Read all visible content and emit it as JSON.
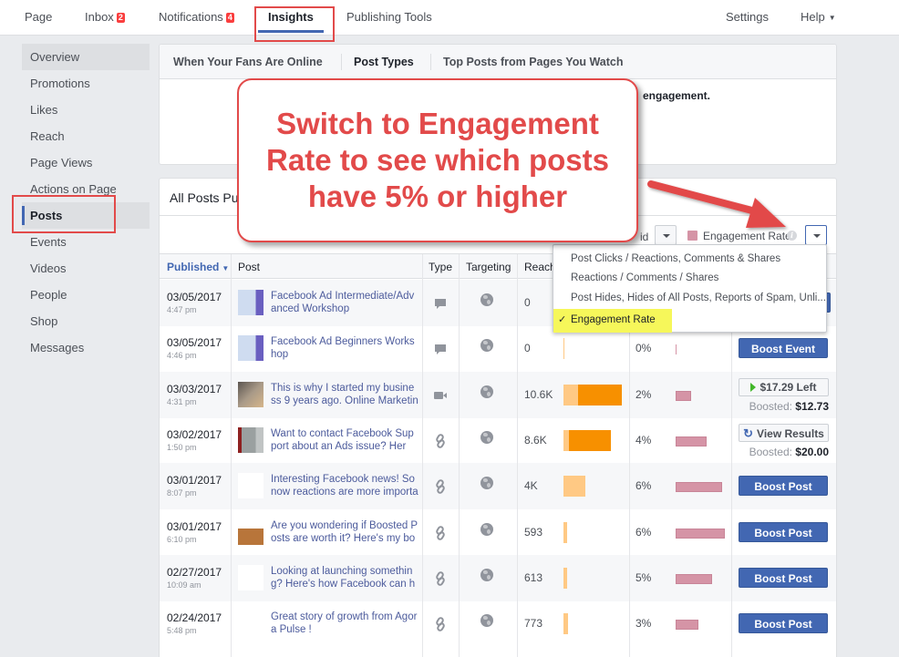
{
  "topnav": {
    "tabs": [
      {
        "label": "Page"
      },
      {
        "label": "Inbox",
        "badge": "2"
      },
      {
        "label": "Notifications",
        "badge": "4"
      },
      {
        "label": "Insights",
        "active": true
      },
      {
        "label": "Publishing Tools"
      }
    ],
    "settings": "Settings",
    "help": "Help",
    "help_caret": "▼"
  },
  "sidebar": {
    "items": [
      {
        "label": "Overview"
      },
      {
        "label": "Promotions"
      },
      {
        "label": "Likes"
      },
      {
        "label": "Reach"
      },
      {
        "label": "Page Views"
      },
      {
        "label": "Actions on Page"
      },
      {
        "label": "Posts",
        "active": true
      },
      {
        "label": "Events"
      },
      {
        "label": "Videos"
      },
      {
        "label": "People"
      },
      {
        "label": "Shop"
      },
      {
        "label": "Messages"
      }
    ]
  },
  "subtabs": {
    "items": [
      {
        "label": "When Your Fans Are Online"
      },
      {
        "label": "Post Types",
        "active": true
      },
      {
        "label": "Top Posts from Pages You Watch"
      }
    ],
    "body_text": "engagement."
  },
  "posts_card": {
    "title": "All Posts Pu",
    "paid_label": "id",
    "metric_label": "Engagement Rate",
    "info": "i",
    "metric_color": "#d594a6"
  },
  "table": {
    "headers": {
      "published": "Published",
      "sort_caret": "▼",
      "post": "Post",
      "type": "Type",
      "targeting": "Targeting",
      "reach": "Reach"
    },
    "rows": [
      {
        "date": "03/05/2017",
        "time": "4:47 pm",
        "text": "Facebook Ad Intermediate/Advanced Workshop",
        "type": "comment-icon",
        "targeting": "globe-icon",
        "reach": "0",
        "reach_organic": 0,
        "reach_paid": 0,
        "engagement": "",
        "engagement_value": 0,
        "action": "hidden"
      },
      {
        "date": "03/05/2017",
        "time": "4:46 pm",
        "text": "Facebook Ad Beginners Workshop",
        "type": "comment-icon",
        "targeting": "globe-icon",
        "reach": "0",
        "reach_organic": 0,
        "reach_paid": 0,
        "engagement": "0%",
        "engagement_value": 0,
        "action": "Boost Event"
      },
      {
        "date": "03/03/2017",
        "time": "4:31 pm",
        "text": "This is why I started my business 9 years ago. Online Marketing",
        "type": "video-icon",
        "targeting": "globe-icon",
        "reach": "10.6K",
        "reach_organic": 2.7,
        "reach_paid": 7.9,
        "engagement": "2%",
        "engagement_value": 2,
        "action_left": "$17.29 Left",
        "boosted_label": "Boosted:",
        "boosted_amount": "$12.73"
      },
      {
        "date": "03/02/2017",
        "time": "1:50 pm",
        "text": "Want to contact Facebook Support about an Ads issue? Here's a",
        "type": "link-icon",
        "targeting": "globe-icon",
        "reach": "8.6K",
        "reach_organic": 1.0,
        "reach_paid": 7.6,
        "engagement": "4%",
        "engagement_value": 4,
        "action_results": "View Results",
        "boosted_label": "Boosted:",
        "boosted_amount": "$20.00"
      },
      {
        "date": "03/01/2017",
        "time": "8:07 pm",
        "text": "Interesting Facebook news! So now reactions are more importa",
        "type": "link-icon",
        "targeting": "globe-icon",
        "reach": "4K",
        "reach_organic": 4.0,
        "reach_paid": 0,
        "engagement": "6%",
        "engagement_value": 6,
        "action": "Boost Post"
      },
      {
        "date": "03/01/2017",
        "time": "6:10 pm",
        "text": "Are you wondering if Boosted Posts are worth it? Here's my boo",
        "type": "link-icon",
        "targeting": "globe-icon",
        "reach": "593",
        "reach_organic": 0.593,
        "reach_paid": 0,
        "engagement": "6%",
        "engagement_value": 6.3,
        "action": "Boost Post"
      },
      {
        "date": "02/27/2017",
        "time": "10:09 am",
        "text": "Looking at launching something? Here's how Facebook can he",
        "type": "link-icon",
        "targeting": "globe-icon",
        "reach": "613",
        "reach_organic": 0.613,
        "reach_paid": 0,
        "engagement": "5%",
        "engagement_value": 4.7,
        "action": "Boost Post"
      },
      {
        "date": "02/24/2017",
        "time": "5:48 pm",
        "text": "Great story of growth from Agora Pulse !",
        "type": "link-icon",
        "targeting": "globe-icon",
        "reach": "773",
        "reach_organic": 0.773,
        "reach_paid": 0,
        "engagement": "3%",
        "engagement_value": 2.9,
        "action": "Boost Post"
      }
    ],
    "reach_max": 10.6,
    "engagement_max": 6.3
  },
  "menu": {
    "items": [
      {
        "label": "Post Clicks / Reactions, Comments & Shares"
      },
      {
        "label": "Reactions / Comments / Shares"
      },
      {
        "label": "Post Hides, Hides of All Posts, Reports of Spam, Unli..."
      },
      {
        "label": "Engagement Rate",
        "checked": true
      }
    ],
    "check": "✓"
  },
  "callout": {
    "line1": "Switch to Engagement",
    "line2": "Rate to see which posts",
    "line3": "have 5% or higher"
  }
}
